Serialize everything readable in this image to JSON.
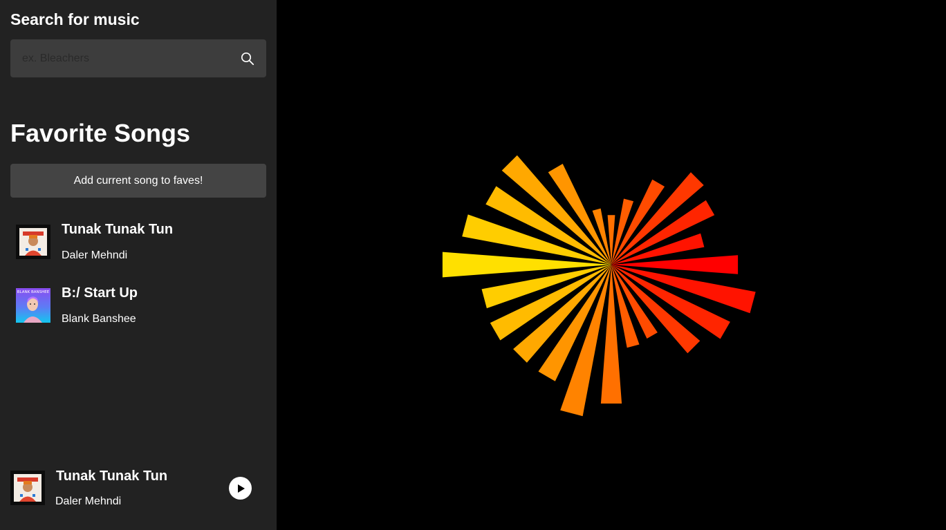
{
  "search": {
    "heading": "Search for music",
    "placeholder": "ex. Bleachers",
    "value": ""
  },
  "favorites": {
    "heading": "Favorite Songs",
    "add_button_label": "Add current song to faves!",
    "songs": [
      {
        "title": "Tunak Tunak Tun",
        "artist": "Daler Mehndi",
        "cover_icon": "album-cover-tunak"
      },
      {
        "title": "B:/ Start Up",
        "artist": "Blank Banshee",
        "cover_icon": "album-cover-blank-banshee",
        "cover_text": "BLANK BANSHEE"
      }
    ]
  },
  "now_playing": {
    "title": "Tunak Tunak Tun",
    "artist": "Daler Mehndi",
    "play_icon": "play-icon"
  },
  "visualizer": {
    "type": "radial-bars",
    "color_low": "#ffe000",
    "color_high": "#ff0000",
    "bar_count": 24,
    "levels": [
      0.51,
      0.59,
      0.53,
      0.47,
      0.33,
      0.34,
      0.56,
      0.62,
      0.52,
      0.52,
      0.54,
      0.53,
      0.68,
      0.61,
      0.56,
      0.58,
      0.45,
      0.23,
      0.2,
      0.27,
      0.38,
      0.49,
      0.46,
      0.38
    ],
    "levels_upper_half_scale": true
  },
  "colors": {
    "sidebar_bg": "#222222",
    "input_bg": "#3d3d3d",
    "button_bg": "#444444",
    "visualizer_bg": "#000000"
  }
}
